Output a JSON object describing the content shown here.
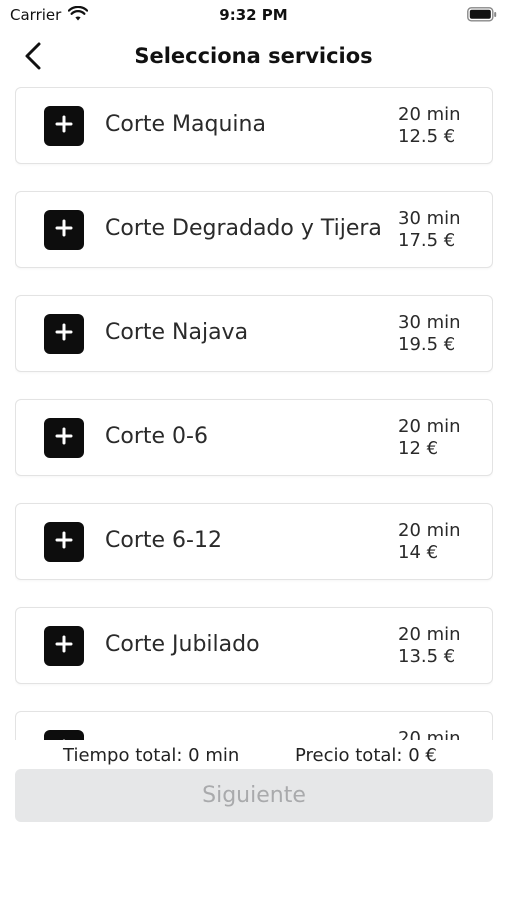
{
  "status_bar": {
    "carrier": "Carrier",
    "time": "9:32 PM"
  },
  "header": {
    "title": "Selecciona servicios"
  },
  "services": [
    {
      "name": "Corte Maquina",
      "duration": "20 min",
      "price": "12.5 €"
    },
    {
      "name": "Corte Degradado y Tijera",
      "duration": "30 min",
      "price": "17.5 €"
    },
    {
      "name": "Corte Najava",
      "duration": "30 min",
      "price": "19.5 €"
    },
    {
      "name": "Corte 0-6",
      "duration": "20 min",
      "price": "12 €"
    },
    {
      "name": "Corte 6-12",
      "duration": "20 min",
      "price": "14 €"
    },
    {
      "name": "Corte Jubilado",
      "duration": "20 min",
      "price": "13.5 €"
    },
    {
      "name": "",
      "duration": "20 min",
      "price": ""
    }
  ],
  "totals": {
    "time": "Tiempo total: 0 min",
    "price": "Precio total: 0 €"
  },
  "next_button": {
    "label": "Siguiente"
  },
  "colors": {
    "add_button": "#0d0d0d",
    "next_button_bg": "#e6e7e8",
    "next_button_text": "#a9aaac"
  }
}
